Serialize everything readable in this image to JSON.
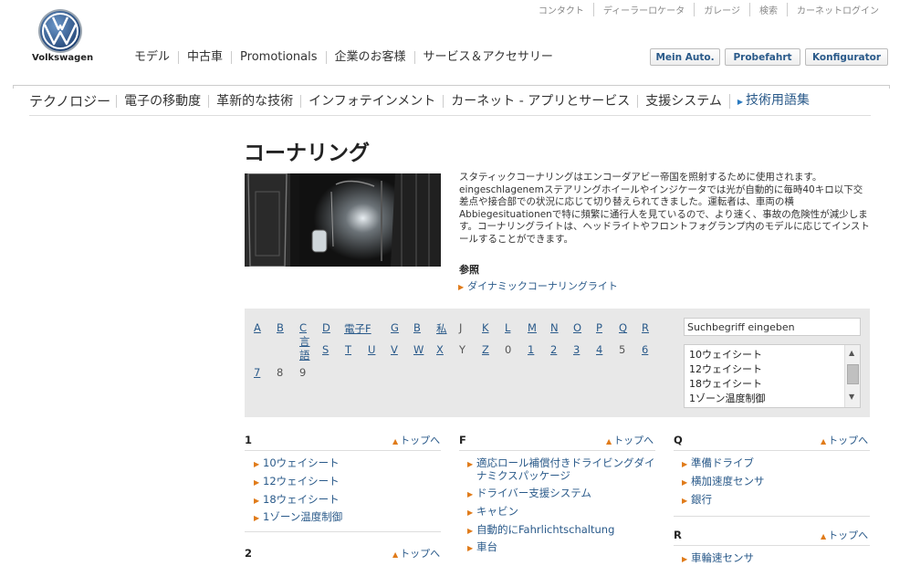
{
  "brand": {
    "name": "Volkswagen"
  },
  "utility_nav": [
    "コンタクト",
    "ディーラーロケータ",
    "ガレージ",
    "検索",
    "カーネットログイン"
  ],
  "main_nav": [
    "モデル",
    "中古車",
    "Promotionals",
    "企業のお客様",
    "サービス＆アクセサリー"
  ],
  "header_buttons": [
    "Mein Auto.",
    "Probefahrt",
    "Konfigurator"
  ],
  "section_nav": {
    "title": "テクノロジー",
    "items": [
      "電子の移動度",
      "革新的な技術",
      "インフォテインメント",
      "カーネット - アプリとサービス",
      "支援システム",
      "技術用語集"
    ]
  },
  "article": {
    "title": "コーナリング",
    "description": "スタティックコーナリングはエンコーダアビー帝国を照射するために使用されます。eingeschlagenemステアリングホイールやインジケータでは光が自動的に毎時40キロ以下交差点や接合部での状況に応じて切り替えられてきました。運転者は、車両の横Abbiegesituationenで特に頻繁に通行人を見ているので、より速く、事故の危険性が減少します。コーナリングライトは、ヘッドライトやフロントフォグランプ内のモデルに応じてインストールすることができます。",
    "refs_heading": "参照",
    "refs": [
      "ダイナミックコーナリングライト"
    ]
  },
  "az": {
    "row1": [
      {
        "t": "A",
        "link": true
      },
      {
        "t": "B",
        "link": true
      },
      {
        "t": "C言語",
        "link": true
      },
      {
        "t": "D",
        "link": true
      },
      {
        "t": "電子F",
        "link": true
      },
      {
        "t": "G",
        "link": true
      },
      {
        "t": "B",
        "link": true
      },
      {
        "t": "私",
        "link": true
      },
      {
        "t": "J",
        "link": false
      },
      {
        "t": "K",
        "link": true
      },
      {
        "t": "L",
        "link": true
      },
      {
        "t": "M",
        "link": true
      },
      {
        "t": "N",
        "link": true
      },
      {
        "t": "O",
        "link": true
      },
      {
        "t": "P",
        "link": true
      },
      {
        "t": "Q",
        "link": true
      },
      {
        "t": "R",
        "link": true
      }
    ],
    "row2": [
      {
        "t": "S",
        "link": true
      },
      {
        "t": "T",
        "link": true
      },
      {
        "t": "U",
        "link": true
      },
      {
        "t": "V",
        "link": true
      },
      {
        "t": "W",
        "link": true
      },
      {
        "t": "X",
        "link": true
      },
      {
        "t": "Y",
        "link": false
      },
      {
        "t": "Z",
        "link": true
      },
      {
        "t": "0",
        "link": false
      },
      {
        "t": "1",
        "link": true
      },
      {
        "t": "2",
        "link": true
      },
      {
        "t": "3",
        "link": true
      },
      {
        "t": "4",
        "link": true
      },
      {
        "t": "5",
        "link": false
      },
      {
        "t": "6",
        "link": true
      }
    ],
    "row3": [
      {
        "t": "7",
        "link": true
      },
      {
        "t": "8",
        "link": false
      },
      {
        "t": "9",
        "link": false
      }
    ]
  },
  "search": {
    "value": "Suchbegriff eingeben"
  },
  "listbox": [
    "10ウェイシート",
    "12ウェイシート",
    "18ウェイシート",
    "1ゾーン温度制御"
  ],
  "top_label": "トップへ",
  "groups": {
    "g1": {
      "heading": "1",
      "items": [
        "10ウェイシート",
        "12ウェイシート",
        "18ウェイシート",
        "1ゾーン温度制御"
      ]
    },
    "g2": {
      "heading": "2"
    },
    "gF": {
      "heading": "F",
      "items": [
        "適応ロール補償付きドライビングダイナミクスパッケージ",
        "ドライバー支援システム",
        "キャビン",
        "自動的にFahrlichtschaltung",
        "車台"
      ]
    },
    "gQ": {
      "heading": "Q",
      "items": [
        "準備ドライブ",
        "横加速度センサ",
        "銀行"
      ]
    },
    "gR": {
      "heading": "R",
      "items": [
        "車輪速センサ"
      ]
    }
  }
}
